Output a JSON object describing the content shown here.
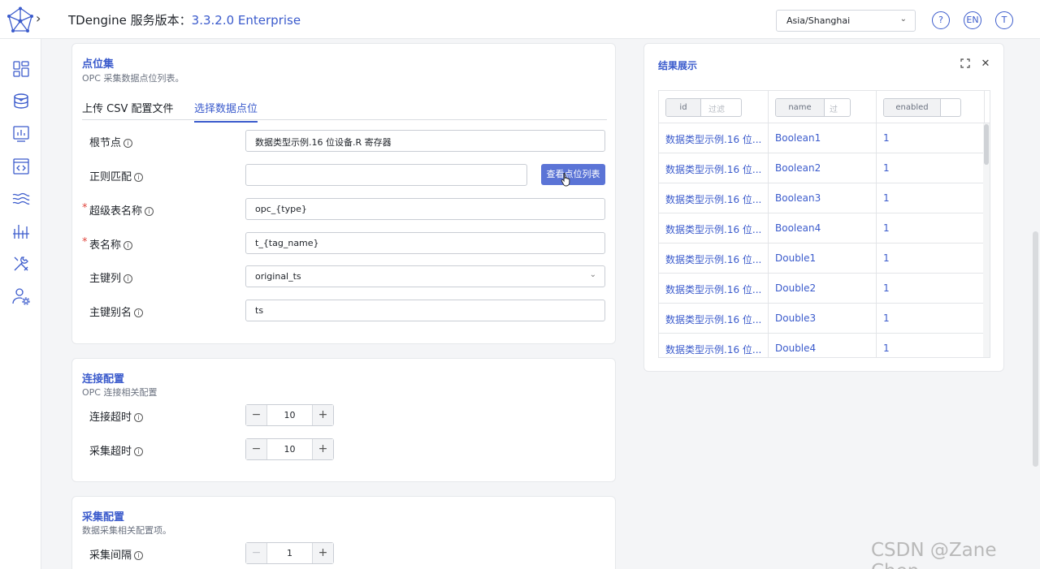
{
  "header": {
    "title_prefix": "TDengine 服务版本：",
    "version": "3.3.2.0 Enterprise",
    "timezone": "Asia/Shanghai",
    "help_label": "?",
    "lang_label": "EN",
    "user_label": "T"
  },
  "nav": {
    "items": [
      "dashboard-icon",
      "database-icon",
      "monitor-icon",
      "code-icon",
      "stream-icon",
      "chart-bars-icon",
      "tools-icon",
      "user-settings-icon"
    ],
    "active": "database-icon"
  },
  "points": {
    "title": "点位集",
    "subtitle": "OPC 采集数据点位列表。",
    "tabs": [
      {
        "label": "上传 CSV 配置文件",
        "active": false
      },
      {
        "label": "选择数据点位",
        "active": true
      }
    ],
    "root_node": {
      "label": "根节点",
      "value": "数据类型示例.16 位设备.R 寄存器"
    },
    "regex": {
      "label": "正则匹配",
      "value": ""
    },
    "view_button": "查看点位列表",
    "stable_name": {
      "label": "超级表名称",
      "value": "opc_{type}",
      "required": true
    },
    "table_name": {
      "label": "表名称",
      "value": "t_{tag_name}",
      "required": true
    },
    "primary_key": {
      "label": "主键列",
      "value": "original_ts"
    },
    "primary_alias": {
      "label": "主键别名",
      "value": "ts"
    }
  },
  "connection": {
    "title": "连接配置",
    "subtitle": "OPC 连接相关配置",
    "connect_timeout": {
      "label": "连接超时",
      "value": "10"
    },
    "collect_timeout": {
      "label": "采集超时",
      "value": "10"
    }
  },
  "collection": {
    "title": "采集配置",
    "subtitle": "数据采集相关配置项。",
    "interval": {
      "label": "采集间隔",
      "value": "1"
    }
  },
  "result": {
    "title": "结果展示",
    "columns": [
      {
        "name": "id",
        "placeholder": "过滤"
      },
      {
        "name": "name",
        "placeholder": "过"
      },
      {
        "name": "enabled",
        "placeholder": ""
      }
    ],
    "rows": [
      {
        "id": "数据类型示例.16 位...",
        "name": "Boolean1",
        "enabled": "1"
      },
      {
        "id": "数据类型示例.16 位...",
        "name": "Boolean2",
        "enabled": "1"
      },
      {
        "id": "数据类型示例.16 位...",
        "name": "Boolean3",
        "enabled": "1"
      },
      {
        "id": "数据类型示例.16 位...",
        "name": "Boolean4",
        "enabled": "1"
      },
      {
        "id": "数据类型示例.16 位...",
        "name": "Double1",
        "enabled": "1"
      },
      {
        "id": "数据类型示例.16 位...",
        "name": "Double2",
        "enabled": "1"
      },
      {
        "id": "数据类型示例.16 位...",
        "name": "Double3",
        "enabled": "1"
      },
      {
        "id": "数据类型示例.16 位...",
        "name": "Double4",
        "enabled": "1"
      }
    ]
  },
  "watermark": "CSDN @Zane Chen",
  "colors": {
    "accent": "#3b5bcc",
    "button": "#5b74d6",
    "required": "#e0463e"
  }
}
